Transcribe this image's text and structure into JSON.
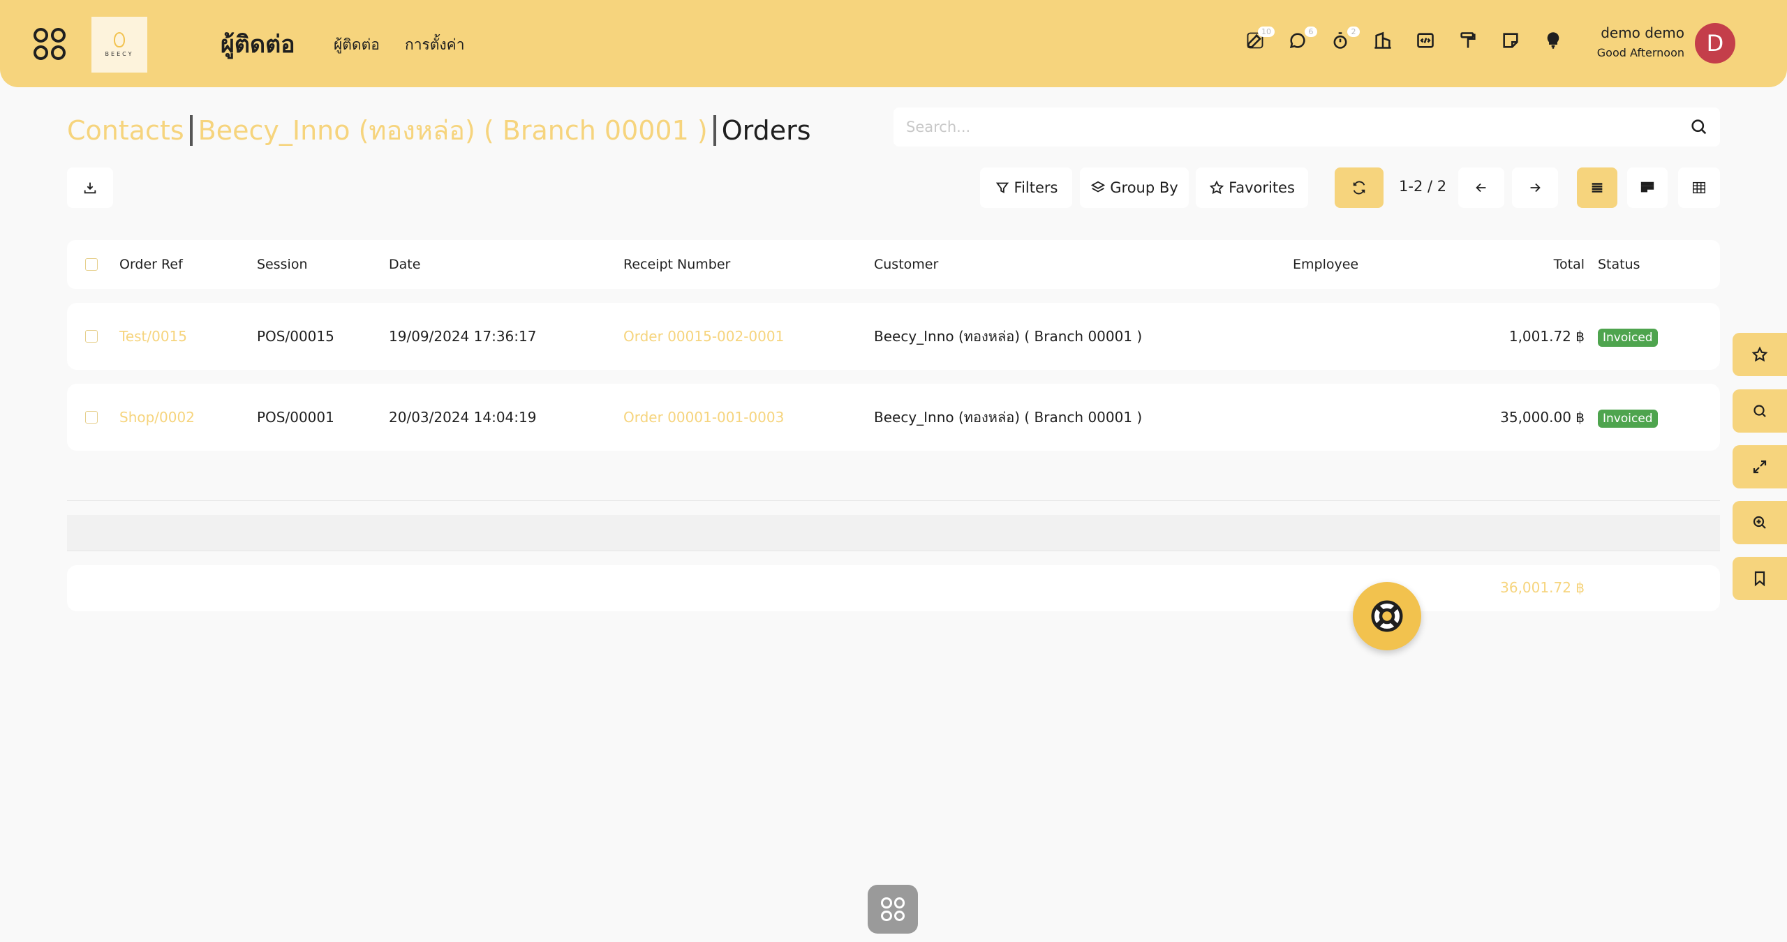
{
  "navbar": {
    "logo_text": "BEECY",
    "app_title": "ผู้ติดต่อ",
    "menu": [
      "ผู้ติดต่อ",
      "การตั้งค่า"
    ],
    "icons": [
      {
        "name": "edit-icon",
        "badge": "10"
      },
      {
        "name": "chat-icon",
        "badge": "6"
      },
      {
        "name": "stopwatch-icon",
        "badge": "2"
      },
      {
        "name": "company-icon",
        "badge": ""
      },
      {
        "name": "code-icon",
        "badge": ""
      },
      {
        "name": "paint-roller-icon",
        "badge": ""
      },
      {
        "name": "sticky-note-icon",
        "badge": ""
      },
      {
        "name": "lightbulb-icon",
        "badge": ""
      }
    ],
    "user_name": "demo demo",
    "greeting": "Good Afternoon",
    "avatar_letter": "D"
  },
  "breadcrumb": {
    "items": [
      "Contacts",
      "Beecy_Inno (ทองหล่อ)  ( Branch 00001 )"
    ],
    "current": "Orders"
  },
  "search": {
    "placeholder": "Search..."
  },
  "toolbar": {
    "filters": "Filters",
    "group_by": "Group By",
    "favorites": "Favorites",
    "pager": "1-2 / 2"
  },
  "table": {
    "headers": {
      "order_ref": "Order Ref",
      "session": "Session",
      "date": "Date",
      "receipt": "Receipt Number",
      "customer": "Customer",
      "employee": "Employee",
      "total": "Total",
      "status": "Status"
    },
    "rows": [
      {
        "order_ref": "Test/0015",
        "session": "POS/00015",
        "date": "19/09/2024 17:36:17",
        "receipt": "Order 00015-002-0001",
        "customer": "Beecy_Inno (ทองหล่อ) ( Branch 00001 )",
        "employee": "",
        "total": "1,001.72 ฿",
        "status": "Invoiced"
      },
      {
        "order_ref": "Shop/0002",
        "session": "POS/00001",
        "date": "20/03/2024 14:04:19",
        "receipt": "Order 00001-001-0003",
        "customer": "Beecy_Inno (ทองหล่อ) ( Branch 00001 )",
        "employee": "",
        "total": "35,000.00 ฿",
        "status": "Invoiced"
      }
    ],
    "sum_total": "36,001.72 ฿"
  },
  "colors": {
    "brand": "#f6d47d",
    "status_invoiced": "#4ea44e",
    "avatar": "#c43e4a"
  }
}
